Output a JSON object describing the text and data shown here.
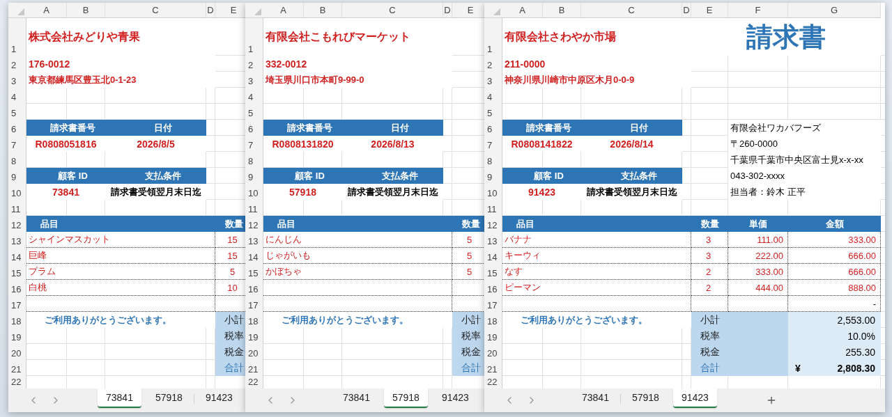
{
  "windows": [
    {
      "columns": [
        "A",
        "B",
        "C",
        "D",
        "E"
      ],
      "row_numbers": [
        "1",
        "2",
        "3",
        "4",
        "5",
        "6",
        "7",
        "8",
        "9",
        "10",
        "11",
        "12",
        "13",
        "14",
        "15",
        "16",
        "17",
        "18",
        "19",
        "20",
        "21",
        "22"
      ],
      "company": "株式会社みどりや青果",
      "postal": "176-0012",
      "address": "東京都練馬区豊玉北0-1-23",
      "invoice_number_label": "請求書番号",
      "date_label": "日付",
      "invoice_number": "R0808051816",
      "date": "2026/8/5",
      "customer_id_label": "顧客 ID",
      "terms_label": "支払条件",
      "customer_id": "73841",
      "terms": "請求書受領翌月末日迄",
      "item_headers": [
        "品目",
        "数量"
      ],
      "items": [
        {
          "name": "シャインマスカット",
          "qty": "15"
        },
        {
          "name": "巨峰",
          "qty": "15"
        },
        {
          "name": "プラム",
          "qty": "5"
        },
        {
          "name": "白桃",
          "qty": "10"
        }
      ],
      "thanks": "ご利用ありがとうございます。",
      "summary": [
        {
          "kind": "line",
          "label": "小計"
        },
        {
          "kind": "line",
          "label": "税率"
        },
        {
          "kind": "line",
          "label": "税金"
        },
        {
          "kind": "total",
          "label": "合計"
        }
      ],
      "tabs": [
        {
          "label": "73841",
          "selected": true
        },
        {
          "label": "57918",
          "selected": false
        },
        {
          "label": "91423",
          "selected": false
        }
      ]
    },
    {
      "columns": [
        "A",
        "B",
        "C",
        "D",
        "E"
      ],
      "row_numbers": [
        "1",
        "2",
        "3",
        "4",
        "5",
        "6",
        "7",
        "8",
        "9",
        "10",
        "11",
        "12",
        "13",
        "14",
        "15",
        "16",
        "17",
        "18",
        "19",
        "20",
        "21",
        "22"
      ],
      "company": "有限会社こもれびマーケット",
      "postal": "332-0012",
      "address": "埼玉県川口市本町9-99-0",
      "invoice_number_label": "請求書番号",
      "date_label": "日付",
      "invoice_number": "R0808131820",
      "date": "2026/8/13",
      "customer_id_label": "顧客 ID",
      "terms_label": "支払条件",
      "customer_id": "57918",
      "terms": "請求書受領翌月末日迄",
      "item_headers": [
        "品目",
        "数量"
      ],
      "items": [
        {
          "name": "にんじん",
          "qty": "5"
        },
        {
          "name": "じゃがいも",
          "qty": "5"
        },
        {
          "name": "かぼちゃ",
          "qty": "5"
        }
      ],
      "thanks": "ご利用ありがとうございます。",
      "summary": [
        {
          "kind": "line",
          "label": "小計"
        },
        {
          "kind": "line",
          "label": "税率"
        },
        {
          "kind": "line",
          "label": "税金"
        },
        {
          "kind": "total",
          "label": "合計"
        }
      ],
      "tabs": [
        {
          "label": "73841",
          "selected": false
        },
        {
          "label": "57918",
          "selected": true
        },
        {
          "label": "91423",
          "selected": false
        }
      ]
    },
    {
      "columns": [
        "A",
        "B",
        "C",
        "D",
        "E",
        "F",
        "G"
      ],
      "row_numbers": [
        "1",
        "2",
        "3",
        "4",
        "5",
        "6",
        "7",
        "8",
        "9",
        "10",
        "11",
        "12",
        "13",
        "14",
        "15",
        "16",
        "17",
        "18",
        "19",
        "20",
        "21",
        "22"
      ],
      "company": "有限会社さわやか市場",
      "title": "請求書",
      "postal": "211-0000",
      "address": "神奈川県川崎市中原区木月0-0-9",
      "invoice_number_label": "請求書番号",
      "date_label": "日付",
      "invoice_number": "R0808141822",
      "date": "2026/8/14",
      "customer_id_label": "顧客 ID",
      "terms_label": "支払条件",
      "customer_id": "91423",
      "terms": "請求書受領翌月末日迄",
      "sender": [
        "有限会社ワカバフーズ",
        "〒260-0000",
        "千葉県千葉市中央区富士見x-x-xx",
        "043-302-xxxx",
        "担当者：鈴木 正平"
      ],
      "item_headers": [
        "品目",
        "数量",
        "単価",
        "金額"
      ],
      "items": [
        {
          "name": "バナナ",
          "qty": "3",
          "price": "111.00",
          "amount": "333.00"
        },
        {
          "name": "キーウィ",
          "qty": "3",
          "price": "222.00",
          "amount": "666.00"
        },
        {
          "name": "なす",
          "qty": "2",
          "price": "333.00",
          "amount": "666.00"
        },
        {
          "name": "ピーマン",
          "qty": "2",
          "price": "444.00",
          "amount": "888.00"
        },
        {
          "amount": "-"
        }
      ],
      "thanks": "ご利用ありがとうございます。",
      "summary": [
        {
          "kind": "line",
          "label": "小計",
          "value": "2,553.00"
        },
        {
          "kind": "line",
          "label": "税率",
          "value": "10.0%"
        },
        {
          "kind": "line",
          "label": "税金",
          "value": "255.30"
        },
        {
          "kind": "total",
          "label": "合計",
          "currency": "¥",
          "value": "2,808.30"
        }
      ],
      "tabs": [
        {
          "label": "73841",
          "selected": false
        },
        {
          "label": "57918",
          "selected": false
        },
        {
          "label": "91423",
          "selected": true
        }
      ],
      "add_sheet_button": true
    }
  ]
}
